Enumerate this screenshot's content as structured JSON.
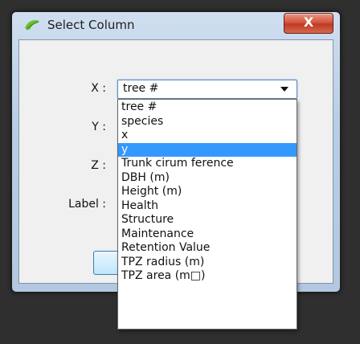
{
  "dialog": {
    "title": "Select Column",
    "close_label": "X"
  },
  "fields": {
    "x_label": "X :",
    "y_label": "Y :",
    "z_label": "Z :",
    "label_label": "Label :"
  },
  "combo": {
    "value": "tree #"
  },
  "dropdown": {
    "options": [
      "tree #",
      "species",
      "x",
      "y",
      "Trunk cirum ference",
      "DBH  (m)",
      "Height   (m)",
      "Health",
      "Structure",
      "Maintenance",
      "Retention Value",
      "TPZ radius   (m)",
      "TPZ area   (m□)"
    ],
    "selected_index": 3
  }
}
